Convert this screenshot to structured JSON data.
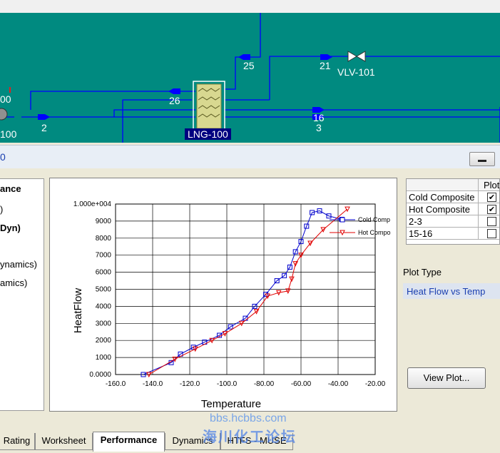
{
  "pfd": {
    "stream_labels": [
      "25",
      "21",
      "26",
      "16",
      "3",
      "2"
    ],
    "valve_label": "VLV-101",
    "exchanger_label": "LNG-100",
    "left_clipped_top": "00",
    "left_clipped_bottom": "100"
  },
  "pane": {
    "title_fragment": "0",
    "left_list": [
      "ance",
      ")",
      "Dyn)",
      "ynamics)",
      "amics)"
    ],
    "series_table": {
      "header": "Plot",
      "rows": [
        {
          "name": "Cold Composite",
          "checked": true
        },
        {
          "name": "Hot Composite",
          "checked": true
        },
        {
          "name": "2-3",
          "checked": false
        },
        {
          "name": "15-16",
          "checked": false
        }
      ]
    },
    "plot_type_label": "Plot Type",
    "plot_type_value": "Heat Flow vs Temp",
    "view_plot_button": "View Plot..."
  },
  "tabs": [
    {
      "label": "Rating",
      "active": false
    },
    {
      "label": "Worksheet",
      "active": false
    },
    {
      "label": "Performance",
      "active": true
    },
    {
      "label": "Dynamics",
      "active": false
    },
    {
      "label": "HTFS - MUSE",
      "active": false
    }
  ],
  "watermark": {
    "line1": "bbs.hcbbs.com",
    "line2": "海川化工论坛"
  },
  "colors": {
    "pfd_bg": "#008a80",
    "stream_blue": "#0000ff",
    "cold": "#0000cc",
    "hot": "#e00000"
  },
  "chart_data": {
    "type": "line",
    "xlabel": "Temperature",
    "ylabel": "HeatFlow",
    "xlim": [
      -160,
      -20
    ],
    "ylim": [
      0,
      10000
    ],
    "xticks": [
      "-160.0",
      "-140.0",
      "-120.0",
      "-100.0",
      "-80.00",
      "-60.00",
      "-40.00",
      "-20.00"
    ],
    "yticks": [
      "0.0000",
      "1000",
      "2000",
      "3000",
      "4000",
      "5000",
      "6000",
      "7000",
      "8000",
      "9000",
      "1.000e+004"
    ],
    "grid": true,
    "legend": "top-right",
    "series": [
      {
        "name": "Cold Comp",
        "marker": "square",
        "x": [
          -145,
          -130,
          -125,
          -118,
          -112,
          -104,
          -98,
          -90,
          -85,
          -79,
          -73,
          -69,
          -66,
          -63,
          -60,
          -57,
          -54,
          -50,
          -45,
          -38
        ],
        "y": [
          0,
          700,
          1200,
          1600,
          1900,
          2300,
          2800,
          3300,
          4000,
          4700,
          5500,
          5800,
          6300,
          7200,
          7800,
          8700,
          9500,
          9600,
          9300,
          9100
        ]
      },
      {
        "name": "Hot Compo",
        "marker": "triangle",
        "x": [
          -142,
          -128,
          -117,
          -108,
          -101,
          -92,
          -84,
          -78,
          -72,
          -67,
          -65,
          -63,
          -60,
          -55,
          -48,
          -35
        ],
        "y": [
          0,
          900,
          1500,
          2000,
          2400,
          3000,
          3700,
          4600,
          4800,
          4900,
          5600,
          6500,
          7000,
          7700,
          8500,
          9700
        ]
      }
    ]
  }
}
